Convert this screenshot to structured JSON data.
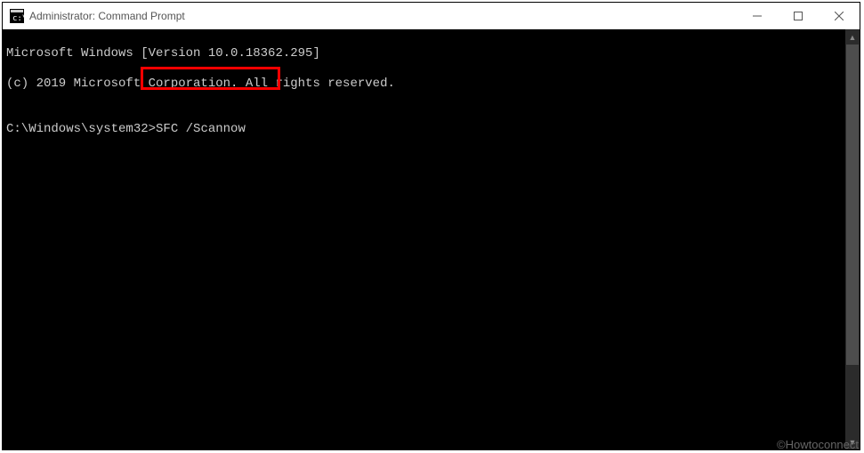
{
  "window": {
    "title": "Administrator: Command Prompt"
  },
  "terminal": {
    "line1": "Microsoft Windows [Version 10.0.18362.295]",
    "line2": "(c) 2019 Microsoft Corporation. All rights reserved.",
    "blank": "",
    "prompt": "C:\\Windows\\system32>",
    "command": "SFC /Scannow"
  },
  "highlight": {
    "color": "#ff0000"
  },
  "watermark": "©Howtoconnect"
}
